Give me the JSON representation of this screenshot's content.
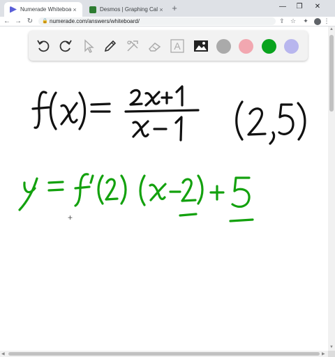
{
  "browser": {
    "tabs": [
      {
        "title": "Numerade Whiteboard",
        "active": true,
        "favicon_color": "#5a5fd8"
      },
      {
        "title": "Desmos | Graphing Calculator",
        "active": false,
        "favicon_color": "#2e7d32"
      }
    ],
    "new_tab": "+",
    "close": "×",
    "url": "numerade.com/answers/whiteboard/"
  },
  "toolbar": {
    "tools": [
      "undo-icon",
      "redo-icon",
      "pointer-icon",
      "pen-icon",
      "tools-icon",
      "eraser-icon",
      "text-icon",
      "image-icon"
    ],
    "text_tool_label": "A",
    "swatches": [
      "#aaaaaa",
      "#f2a7b0",
      "#0aa31e",
      "#b8b6ee"
    ],
    "selected_color": "#0aa31e"
  },
  "whiteboard": {
    "line1_function": "f(x) = (2x+1)/(x−1)",
    "line1_point": "(2,5)",
    "line2_tangent": "y = f′(2)(x−2)+5",
    "ink_black": "#111111",
    "ink_green": "#13a10e"
  }
}
